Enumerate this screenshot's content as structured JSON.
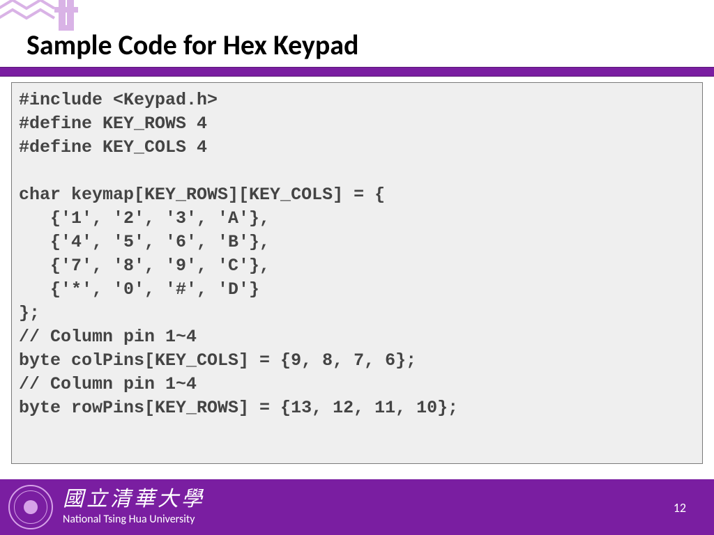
{
  "title": "Sample Code for Hex Keypad",
  "code": "#include <Keypad.h>\n#define KEY_ROWS 4\n#define KEY_COLS 4\n\nchar keymap[KEY_ROWS][KEY_COLS] = {\n   {'1', '2', '3', 'A'},\n   {'4', '5', '6', 'B'},\n   {'7', '8', '9', 'C'},\n   {'*', '0', '#', 'D'}\n};\n// Column pin 1~4\nbyte colPins[KEY_COLS] = {9, 8, 7, 6};\n// Column pin 1~4\nbyte rowPins[KEY_ROWS] = {13, 12, 11, 10};",
  "footer": {
    "chinese": "國立清華大學",
    "english": "National Tsing Hua University"
  },
  "page_number": "12",
  "colors": {
    "accent": "#7a1ea1",
    "code_bg": "#efefef",
    "code_border": "#7a7a7a",
    "logo_outline": "#d9b3e6"
  }
}
